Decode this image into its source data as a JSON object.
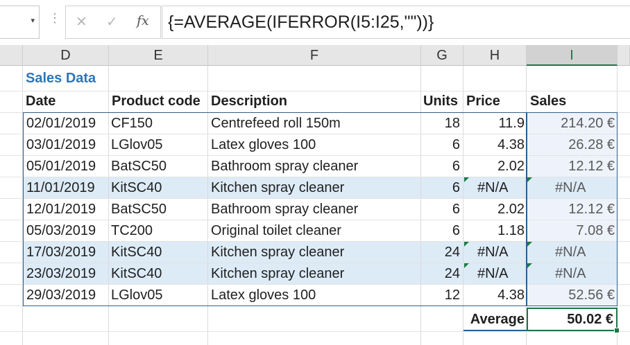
{
  "formula_bar": {
    "namebox_chevron": "▾",
    "dots": "⋮",
    "cancel": "✕",
    "enter": "✓",
    "fx": "fx",
    "formula": "{=AVERAGE(IFERROR(I5:I25,\"\"))}"
  },
  "columns": [
    "D",
    "E",
    "F",
    "G",
    "H",
    "I"
  ],
  "sheet": {
    "title": "Sales Data",
    "headers": [
      "Date",
      "Product code",
      "Description",
      "Units",
      "Price",
      "Sales"
    ],
    "rows": [
      [
        "02/01/2019",
        "CF150",
        "Centrefeed roll 150m",
        "18",
        "11.9",
        "214.20 €"
      ],
      [
        "03/01/2019",
        "LGlov05",
        "Latex gloves 100",
        "6",
        "4.38",
        "26.28 €"
      ],
      [
        "05/01/2019",
        "BatSC50",
        "Bathroom spray cleaner",
        "6",
        "2.02",
        "12.12 €"
      ],
      [
        "11/01/2019",
        "KitSC40",
        "Kitchen spray cleaner",
        "6",
        "#N/A",
        "#N/A"
      ],
      [
        "12/01/2019",
        "BatSC50",
        "Bathroom spray cleaner",
        "6",
        "2.02",
        "12.12 €"
      ],
      [
        "05/03/2019",
        "TC200",
        "Original toilet cleaner",
        "6",
        "1.18",
        "7.08 €"
      ],
      [
        "17/03/2019",
        "KitSC40",
        "Kitchen spray cleaner",
        "24",
        "#N/A",
        "#N/A"
      ],
      [
        "23/03/2019",
        "KitSC40",
        "Kitchen spray cleaner",
        "24",
        "#N/A",
        "#N/A"
      ],
      [
        "29/03/2019",
        "LGlov05",
        "Latex gloves 100",
        "12",
        "4.38",
        "52.56 €"
      ]
    ],
    "average_label": "Average",
    "average_value": "50.02 €"
  },
  "colors": {
    "title": "#2e75b6",
    "highlight_row": "#ddebf7",
    "sales_column": "#eef3fb",
    "table_border": "#2f5f8a",
    "selected_header": "#217346"
  }
}
